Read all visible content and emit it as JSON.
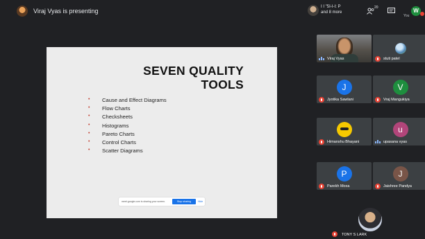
{
  "topbar": {
    "presenting_text": "Viraj Vyas is presenting",
    "participants_line1": "I I \"5I-I-I: P",
    "participants_line2": "and 8 more",
    "people_count": "20",
    "you_label": "You",
    "self_initial": "W"
  },
  "slide": {
    "title_line1": "SEVEN QUALITY",
    "title_line2": "TOOLS",
    "bullet_glyph": "•",
    "items": [
      "Cause and Effect Diagrams",
      "Flow Charts",
      "Checksheets",
      "Histograms",
      "Pareto Charts",
      "Control Charts",
      "Scatter Diagrams"
    ],
    "share_bar": {
      "text": "meet.google.com is sharing your screen.",
      "stop_label": "Stop sharing",
      "hide_label": "Hide"
    }
  },
  "tiles": [
    {
      "name": "Viraj Vyas",
      "type": "video",
      "speaking": true
    },
    {
      "name": "stuti patel",
      "type": "photo"
    },
    {
      "name": "Jyotika Sawlani",
      "initial": "J",
      "color": "#1a73e8"
    },
    {
      "name": "Vraj Mangukiya",
      "initial": "V",
      "color": "#1e8e3e"
    },
    {
      "name": "Himanshu Bhayani",
      "type": "photo"
    },
    {
      "name": "upasana vyas",
      "initial": "u",
      "color": "#b2457a",
      "speaking": true
    },
    {
      "name": "Parekh Moxa",
      "initial": "P",
      "color": "#1a73e8"
    },
    {
      "name": "Jaishree Pandya",
      "initial": "J",
      "color": "#795548"
    },
    {
      "name": "TONY S LARK",
      "type": "photo"
    }
  ]
}
